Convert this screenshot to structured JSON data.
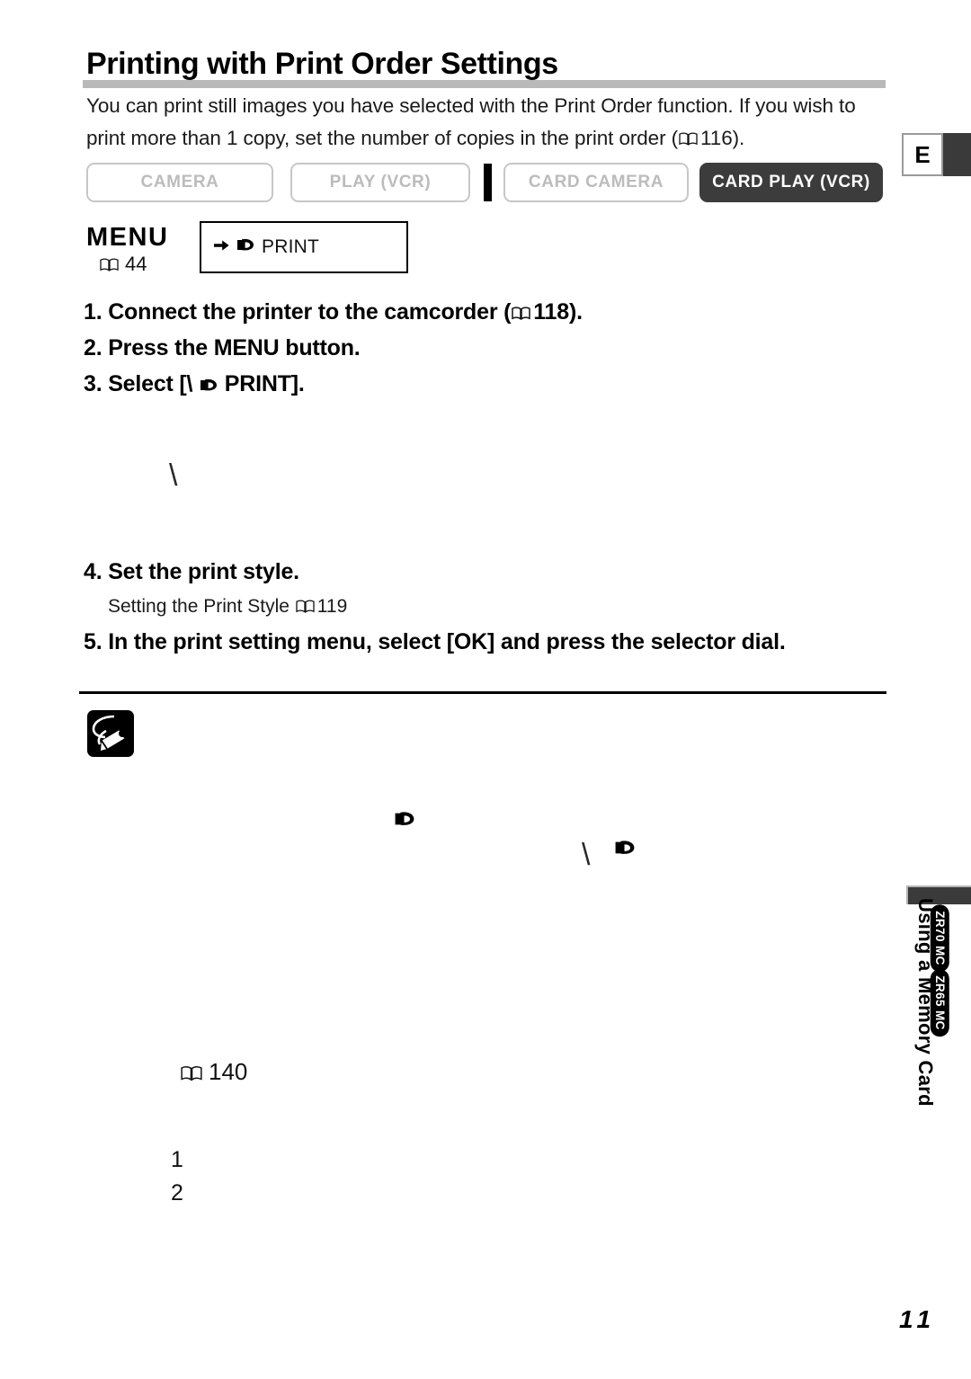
{
  "header": {
    "title": "Printing with Print Order Settings"
  },
  "intro": {
    "text_part1": "You can print still images you have selected with the Print Order function. If you wish to print more than 1 copy, set the number of copies in the print order (",
    "page_ref": "116",
    "text_part2": ")."
  },
  "modes": {
    "camera": "CAMERA",
    "play_vcr": "PLAY (VCR)",
    "card_camera": "CARD CAMERA",
    "card_play_vcr": "CARD PLAY (VCR)",
    "active": "CARD PLAY (VCR)"
  },
  "menu": {
    "label": "MENU",
    "page_ref": "44",
    "item_label": "PRINT"
  },
  "steps": [
    {
      "number": "1.",
      "text_before": "Connect the printer to the camcorder (",
      "page_ref": "118",
      "text_after": ")."
    },
    {
      "number": "2.",
      "text": "Press the MENU button."
    },
    {
      "number": "3.",
      "text_before": "Select [\\",
      "text_after": "PRINT]."
    }
  ],
  "stray_glyphs": {
    "backslash": "\\"
  },
  "steps2": {
    "step4_number": "4.",
    "step4_text": "Set the print style.",
    "step4_sub_text": "Setting the Print Style",
    "step4_sub_ref": "119",
    "step5_number": "5.",
    "step5_text": "In the print setting menu, select [OK] and press the selector dial."
  },
  "notes": {
    "ref_140": "140",
    "list_item_1": "1",
    "list_item_2": "2"
  },
  "side": {
    "language_tab": "E",
    "section_title": "Using a Memory Card",
    "badge_1": "ZR70 MC",
    "badge_2": "ZR65 MC"
  },
  "footer": {
    "page_number": "11"
  },
  "colors": {
    "title_rule": "#b9b9b9",
    "active_mode_bg": "#3c3c3c",
    "inactive_mode_text": "#bdbbbb",
    "badge_bg": "#000000"
  }
}
